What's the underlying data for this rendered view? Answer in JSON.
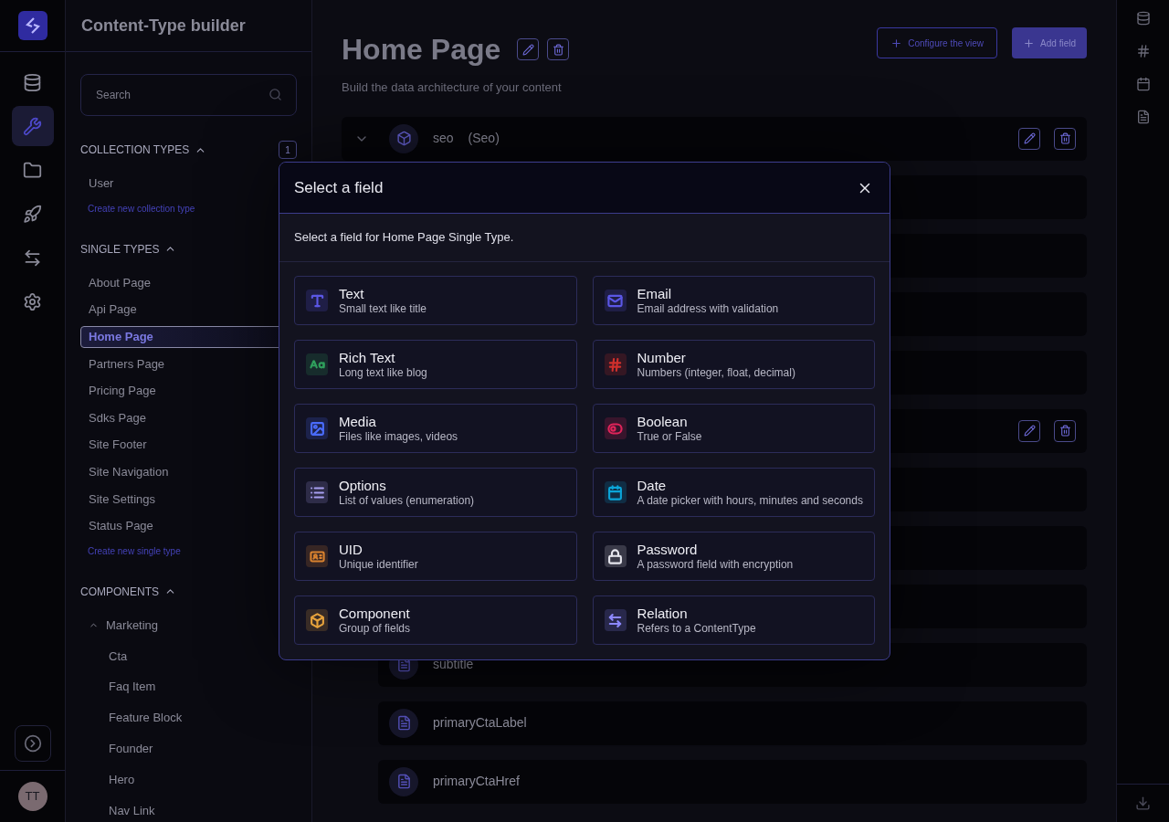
{
  "app": {
    "title": "Content-Type builder",
    "avatar": "TT"
  },
  "nav": [
    {
      "selected": false
    },
    {
      "selected": true
    },
    {
      "selected": false
    },
    {
      "selected": false
    },
    {
      "selected": false
    },
    {
      "selected": false
    }
  ],
  "search": {
    "placeholder": "Search"
  },
  "sections": [
    {
      "title": "COLLECTION TYPES",
      "expanded": true,
      "count": "1",
      "items": [
        {
          "label": "User",
          "selected": false
        }
      ],
      "create": "Create new collection type"
    },
    {
      "title": "SINGLE TYPES",
      "expanded": true,
      "items": [
        {
          "label": "About Page",
          "selected": false
        },
        {
          "label": "Api Page",
          "selected": false
        },
        {
          "label": "Home Page",
          "selected": true
        },
        {
          "label": "Partners Page",
          "selected": false
        },
        {
          "label": "Pricing Page",
          "selected": false
        },
        {
          "label": "Sdks Page",
          "selected": false
        },
        {
          "label": "Site Footer",
          "selected": false
        },
        {
          "label": "Site Navigation",
          "selected": false
        },
        {
          "label": "Site Settings",
          "selected": false
        },
        {
          "label": "Status Page",
          "selected": false
        }
      ],
      "create": "Create new single type"
    },
    {
      "title": "COMPONENTS",
      "expanded": true,
      "groups": [
        {
          "label": "Marketing",
          "expanded": true,
          "items": [
            {
              "label": "Cta"
            },
            {
              "label": "Faq Item"
            },
            {
              "label": "Feature Block"
            },
            {
              "label": "Founder"
            },
            {
              "label": "Hero"
            },
            {
              "label": "Nav Link"
            }
          ]
        }
      ]
    }
  ],
  "page": {
    "title": "Home Page",
    "subtitle": "Build the data architecture of your content",
    "configure": "Configure the view",
    "add": "Add field"
  },
  "fields": [
    {
      "kind": "component",
      "name": "seo",
      "type": "(Seo)",
      "expanded": false
    },
    {
      "kind": "covered"
    },
    {
      "kind": "covered"
    },
    {
      "kind": "covered"
    },
    {
      "kind": "covered"
    },
    {
      "kind": "component",
      "expanded": true,
      "children": [
        {
          "kind": "covered"
        },
        {
          "kind": "covered"
        },
        {
          "kind": "covered"
        },
        {
          "kind": "text",
          "name": "subtitle"
        },
        {
          "kind": "text",
          "name": "primaryCtaLabel"
        },
        {
          "kind": "text",
          "name": "primaryCtaHref"
        }
      ]
    }
  ],
  "modal": {
    "title": "Select a field",
    "subtitle": "Select a field for Home Page Single Type.",
    "options": [
      {
        "kind": "text",
        "name": "Text",
        "description": "Small text like title",
        "color": "#5b57e6"
      },
      {
        "kind": "email",
        "name": "Email",
        "description": "Email address with validation",
        "color": "#5b57e6"
      },
      {
        "kind": "richtext",
        "name": "Rich Text",
        "description": "Long text like blog",
        "color": "#2f9e5c"
      },
      {
        "kind": "number",
        "name": "Number",
        "description": "Numbers (integer, float, decimal)",
        "color": "#d0302c"
      },
      {
        "kind": "media",
        "name": "Media",
        "description": "Files like images, videos",
        "color": "#4a6cff"
      },
      {
        "kind": "boolean",
        "name": "Boolean",
        "description": "True or False",
        "color": "#e0245a"
      },
      {
        "kind": "options",
        "name": "Options",
        "description": "List of values (enumeration)",
        "color": "#a89ff0"
      },
      {
        "kind": "date",
        "name": "Date",
        "description": "A date picker with hours, minutes and seconds",
        "color": "#0ba5d8"
      },
      {
        "kind": "uid",
        "name": "UID",
        "description": "Unique identifier",
        "color": "#d9822f"
      },
      {
        "kind": "password",
        "name": "Password",
        "description": "A password field with encryption",
        "color": "#e6e6ee"
      },
      {
        "kind": "component",
        "name": "Component",
        "description": "Group of fields",
        "color": "#e6a23c"
      },
      {
        "kind": "relation",
        "name": "Relation",
        "description": "Refers to a ContentType",
        "color": "#8c88ff"
      }
    ]
  }
}
